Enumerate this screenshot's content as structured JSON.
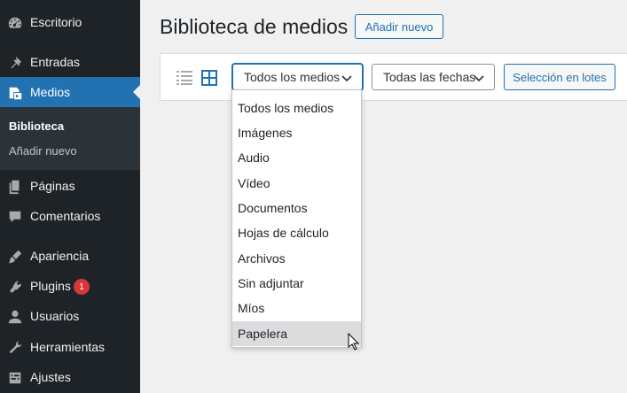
{
  "sidebar": {
    "items": [
      {
        "label": "Escritorio",
        "icon": "dashboard-icon"
      },
      {
        "label": "Entradas",
        "icon": "pin-icon"
      },
      {
        "label": "Medios",
        "icon": "media-icon"
      },
      {
        "label": "Páginas",
        "icon": "pages-icon"
      },
      {
        "label": "Comentarios",
        "icon": "comments-icon"
      },
      {
        "label": "Apariencia",
        "icon": "appearance-icon"
      },
      {
        "label": "Plugins",
        "icon": "plugins-icon"
      },
      {
        "label": "Usuarios",
        "icon": "users-icon"
      },
      {
        "label": "Herramientas",
        "icon": "tools-icon"
      },
      {
        "label": "Ajustes",
        "icon": "settings-icon"
      }
    ],
    "submenu": [
      {
        "label": "Biblioteca"
      },
      {
        "label": "Añadir nuevo"
      }
    ],
    "plugins_badge": "1"
  },
  "header": {
    "title": "Biblioteca de medios",
    "add_new_label": "Añadir nuevo"
  },
  "toolbar": {
    "media_filter": "Todos los medios",
    "date_filter": "Todas las fechas",
    "bulk_select_label": "Selección en lotes"
  },
  "dropdown": {
    "options": [
      "Todos los medios",
      "Imágenes",
      "Audio",
      "Vídeo",
      "Documentos",
      "Hojas de cálculo",
      "Archivos",
      "Sin adjuntar",
      "Míos",
      "Papelera"
    ],
    "hovered": "Papelera"
  },
  "colors": {
    "sidebar_bg": "#1d2327",
    "accent": "#2271b1",
    "badge": "#d63638"
  }
}
